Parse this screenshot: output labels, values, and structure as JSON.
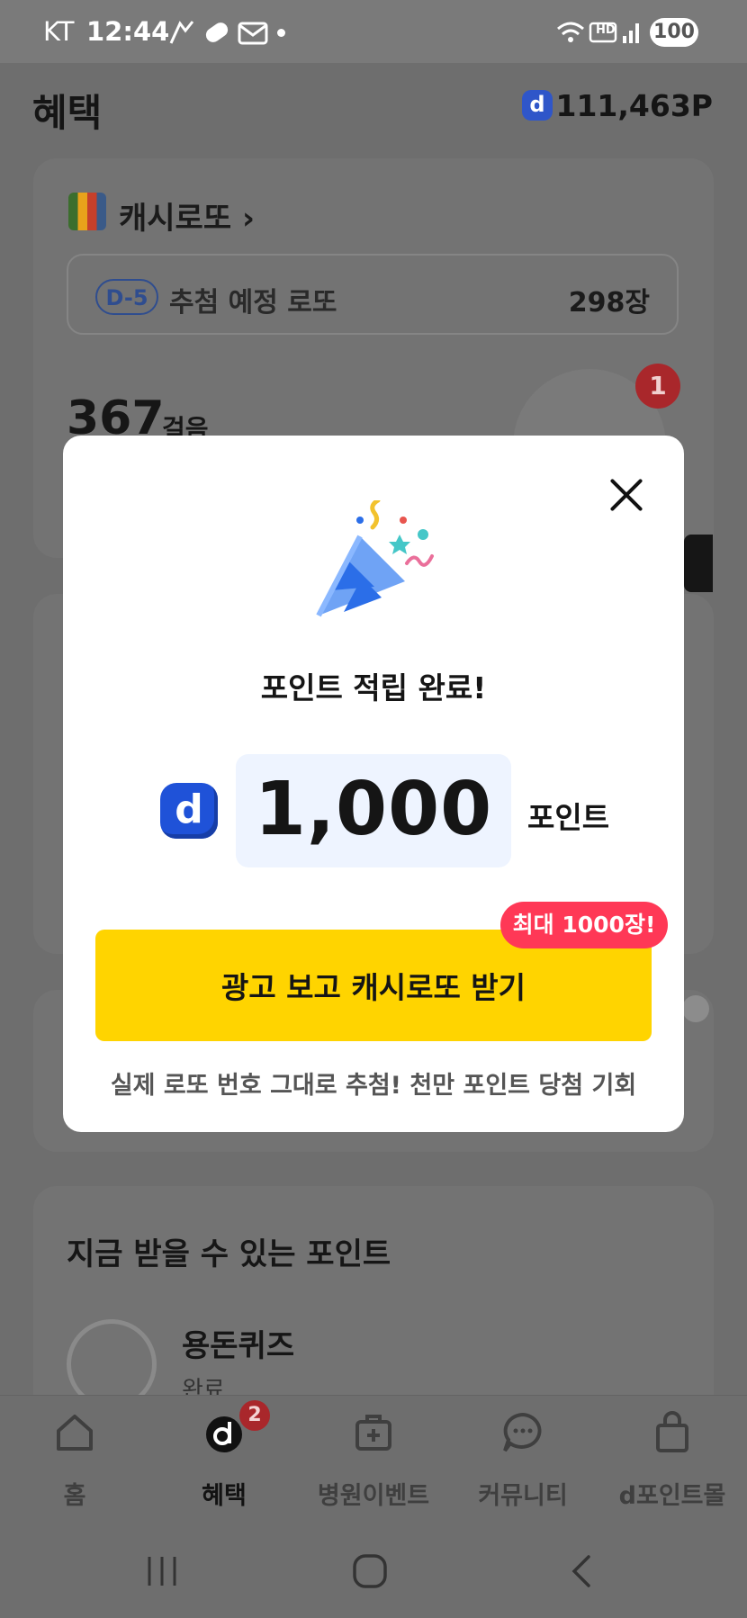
{
  "status_bar": {
    "carrier": "KT",
    "time": "12:44",
    "battery": "100",
    "hd": "HD"
  },
  "header": {
    "title": "혜택",
    "points": "111,463P",
    "coin_icon": "d"
  },
  "lotto_card": {
    "title": "캐시로또",
    "dday": "D-5",
    "scheduled_label": "추첨 예정 로또",
    "scheduled_count": "298장",
    "steps_value": "367",
    "steps_unit": "걸음",
    "badge_count": "1"
  },
  "points_section": {
    "title": "지금 받을 수 있는 포인트",
    "item_title": "용돈퀴즈",
    "item_status": "완료"
  },
  "modal": {
    "title": "포인트 적립 완료!",
    "coin_icon": "d",
    "amount": "1,000",
    "amount_unit": "포인트",
    "cta_label": "광고 보고 캐시로또 받기",
    "cta_badge": "최대 1000장!",
    "footer": "실제 로또 번호 그대로 추첨! 천만 포인트 당첨 기회"
  },
  "bottom_nav": {
    "items": [
      {
        "label": "홈",
        "icon": "home-icon"
      },
      {
        "label": "혜택",
        "icon": "d-benefit-icon",
        "active": true,
        "badge": "2"
      },
      {
        "label": "병원이벤트",
        "icon": "medical-kit-icon"
      },
      {
        "label": "커뮤니티",
        "icon": "chat-bubble-icon"
      },
      {
        "label": "d포인트몰",
        "icon": "shopping-bag-icon"
      }
    ]
  },
  "colors": {
    "accent_yellow": "#ffd400",
    "badge_red": "#ff3856",
    "coin_blue": "#1f52d8",
    "amount_bg": "#eef4ff"
  }
}
